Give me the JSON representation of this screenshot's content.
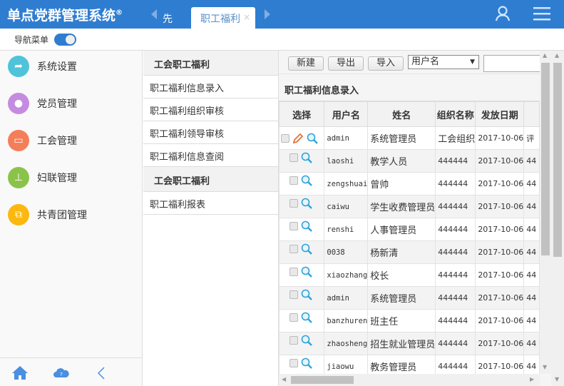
{
  "app": {
    "title": "单点党群管理系统",
    "reg": "®"
  },
  "tabs": [
    {
      "label": "先"
    },
    {
      "label": "职工福利",
      "close": "×"
    }
  ],
  "header_icons": [
    "user-icon",
    "menu-icon"
  ],
  "nav": {
    "label": "导航菜单",
    "toggle_on": true
  },
  "sidebar": {
    "items": [
      {
        "label": "系统设置",
        "icon": "share-icon",
        "color": "#4fc3d9"
      },
      {
        "label": "党员管理",
        "icon": "person-icon",
        "color": "#c58be0"
      },
      {
        "label": "工会管理",
        "icon": "briefcase-icon",
        "color": "#f47e5a"
      },
      {
        "label": "妇联管理",
        "icon": "stamp-icon",
        "color": "#8bc34a"
      },
      {
        "label": "共青团管理",
        "icon": "transfer-icon",
        "color": "#fbb80f"
      }
    ],
    "footer": {
      "help": "?"
    }
  },
  "submenu": {
    "groups": [
      {
        "title": "工会职工福利",
        "items": [
          "职工福利信息录入",
          "职工福利组织审核",
          "职工福利领导审核",
          "职工福利信息查阅"
        ]
      },
      {
        "title": "工会职工福利",
        "items": [
          "职工福利报表"
        ]
      }
    ]
  },
  "toolbar": {
    "new": "新建",
    "export": "导出",
    "import": "导入",
    "select_value": "用户名",
    "search_value": ""
  },
  "grid": {
    "title": "职工福利信息录入",
    "columns": [
      "选择",
      "用户名",
      "姓名",
      "组织名称",
      "发放日期",
      ""
    ],
    "rows": [
      {
        "username": "admin",
        "name": "系统管理员",
        "org": "工会组织",
        "date": "2017-10-06",
        "extra": "评",
        "editable": true
      },
      {
        "username": "laoshi",
        "name": "教学人员",
        "org": "444444",
        "date": "2017-10-06",
        "extra": "44"
      },
      {
        "username": "zengshuai",
        "name": "曾帅",
        "org": "444444",
        "date": "2017-10-06",
        "extra": "44"
      },
      {
        "username": "caiwu",
        "name": "学生收费管理员",
        "org": "444444",
        "date": "2017-10-06",
        "extra": "44"
      },
      {
        "username": "renshi",
        "name": "人事管理员",
        "org": "444444",
        "date": "2017-10-06",
        "extra": "44"
      },
      {
        "username": "0038",
        "name": "杨新清",
        "org": "444444",
        "date": "2017-10-06",
        "extra": "44"
      },
      {
        "username": "xiaozhang",
        "name": "校长",
        "org": "444444",
        "date": "2017-10-06",
        "extra": "44"
      },
      {
        "username": "admin",
        "name": "系统管理员",
        "org": "444444",
        "date": "2017-10-06",
        "extra": "44"
      },
      {
        "username": "banzhuren",
        "name": "班主任",
        "org": "444444",
        "date": "2017-10-06",
        "extra": "44"
      },
      {
        "username": "zhaosheng",
        "name": "招生就业管理员",
        "org": "444444",
        "date": "2017-10-06",
        "extra": "44"
      },
      {
        "username": "jiaowu",
        "name": "教务管理员",
        "org": "444444",
        "date": "2017-10-06",
        "extra": "44"
      }
    ]
  }
}
